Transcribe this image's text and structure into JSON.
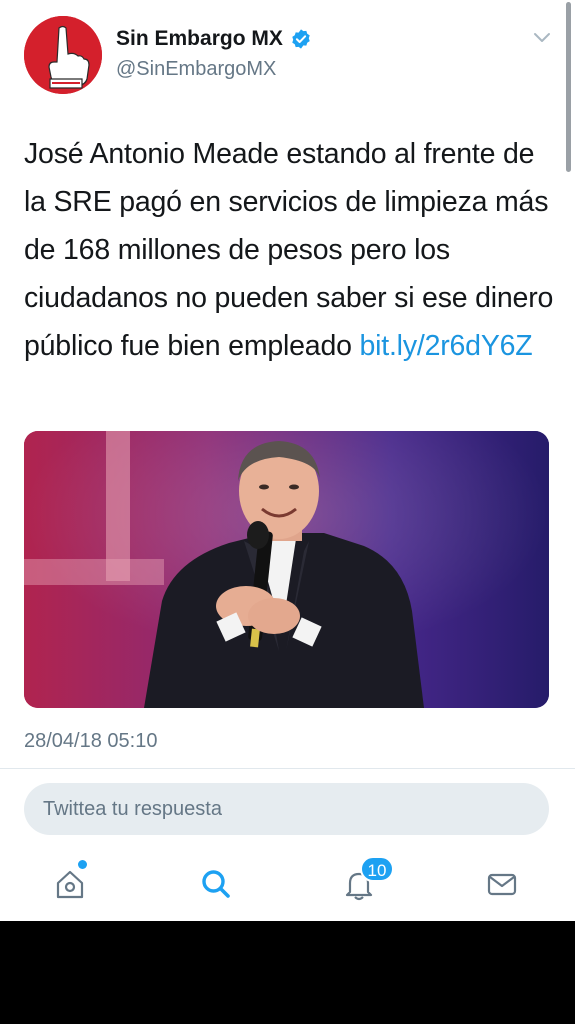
{
  "author": {
    "display_name": "Sin Embargo MX",
    "handle": "@SinEmbargoMX",
    "verified": true
  },
  "tweet": {
    "text": "José Antonio Meade estando al frente de la SRE pagó en servicios de limpieza más de 168 millones de pesos pero los ciudadanos no pueden saber si ese dinero público fue bien empleado ",
    "link": "bit.ly/2r6dY6Z",
    "timestamp": "28/04/18 05:10"
  },
  "reply": {
    "placeholder": "Twittea tu respuesta"
  },
  "tabbar": {
    "notifications_count": "10",
    "items": [
      "home-icon",
      "search-icon",
      "notifications-icon",
      "messages-icon"
    ]
  },
  "colors": {
    "link": "#1b95e0",
    "accent": "#1da1f2",
    "avatar_bg": "#d4202c",
    "muted": "#657786"
  }
}
